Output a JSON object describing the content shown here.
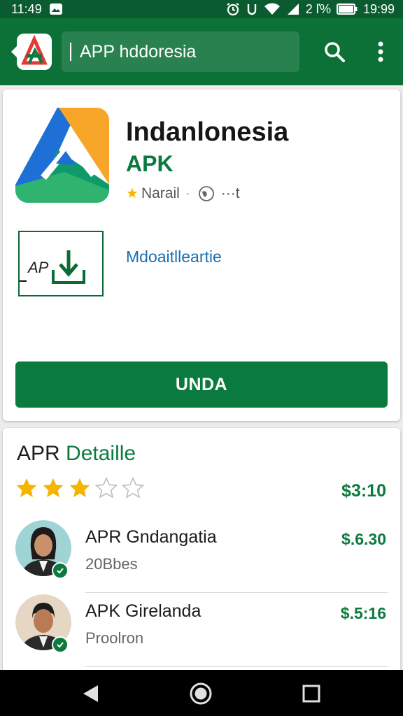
{
  "status_bar": {
    "time": "11:49",
    "battery_text": "2 ľ%",
    "clock_right": "19:99"
  },
  "app_bar": {
    "search_text": "APP hddoresia"
  },
  "app_card": {
    "name": "Indanlonesia",
    "subtitle": "APK",
    "rating_label": "Narail",
    "globe_label": "···t",
    "download_icon_text": "AP",
    "download_link": "Mdoaitlleartie",
    "install_label": "UNDA"
  },
  "details": {
    "title_part1": "APR ",
    "title_part2": "Detaille",
    "rating_value": 3,
    "rating_max": 5,
    "price": "$3:10",
    "rows": [
      {
        "name": "APR Gndangatia",
        "subtitle": "20Bbes",
        "price": "$.6.30"
      },
      {
        "name": "APK Girelanda",
        "subtitle": "Proolron",
        "price": "$.5:16"
      }
    ]
  },
  "colors": {
    "brand_green": "#0b7136",
    "status_green": "#0a5b2f",
    "accent_green": "#0b7a3e",
    "link_blue": "#1a6fb0",
    "star_gold": "#f5b400"
  }
}
